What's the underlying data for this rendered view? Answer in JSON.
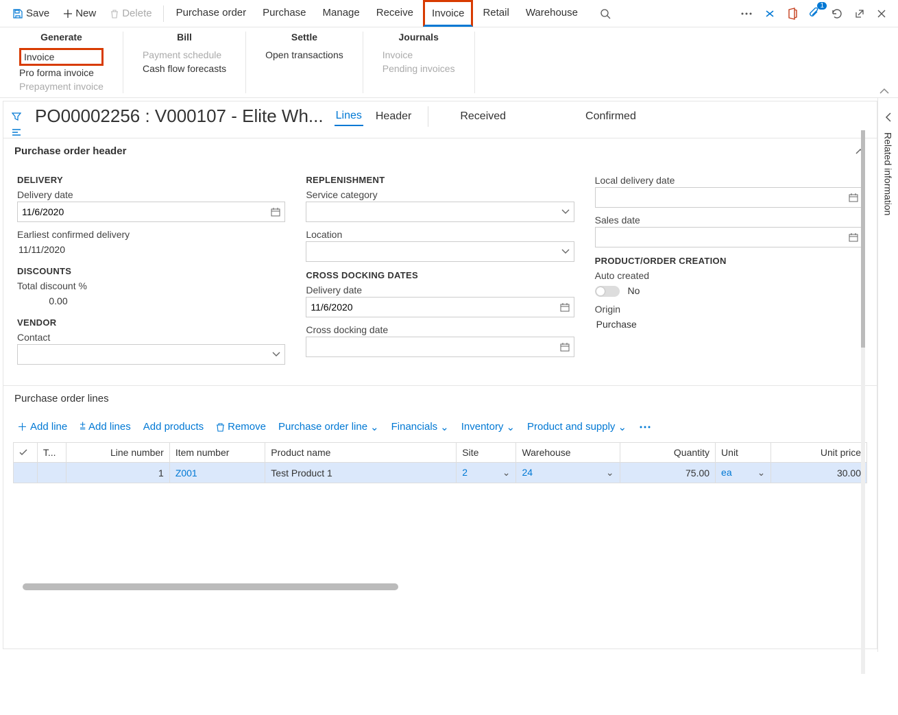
{
  "toolbar": {
    "save": "Save",
    "new": "New",
    "delete": "Delete",
    "tabs": [
      "Purchase order",
      "Purchase",
      "Manage",
      "Receive",
      "Invoice",
      "Retail",
      "Warehouse"
    ],
    "active_tab_index": 4,
    "badge_count": "1"
  },
  "ribbon": {
    "generate": {
      "title": "Generate",
      "items": [
        "Invoice",
        "Pro forma invoice",
        "Prepayment invoice"
      ],
      "disabled": [
        2
      ]
    },
    "bill": {
      "title": "Bill",
      "items": [
        "Payment schedule",
        "Cash flow forecasts"
      ],
      "disabled": [
        0
      ]
    },
    "settle": {
      "title": "Settle",
      "items": [
        "Open transactions"
      ]
    },
    "journals": {
      "title": "Journals",
      "items": [
        "Invoice",
        "Pending invoices"
      ],
      "disabled": [
        0,
        1
      ]
    }
  },
  "page": {
    "title": "PO00002256 : V000107 - Elite Wh...",
    "view_tabs": [
      "Lines",
      "Header"
    ],
    "active_view": 0,
    "status1": "Received",
    "status2": "Confirmed"
  },
  "header_section": {
    "title": "Purchase order header",
    "delivery": {
      "group": "DELIVERY",
      "delivery_date_label": "Delivery date",
      "delivery_date": "11/6/2020",
      "earliest_label": "Earliest confirmed delivery",
      "earliest": "11/11/2020"
    },
    "discounts": {
      "group": "DISCOUNTS",
      "total_pct_label": "Total discount %",
      "total_pct": "0.00"
    },
    "vendor": {
      "group": "VENDOR",
      "contact_label": "Contact",
      "contact": ""
    },
    "replenishment": {
      "group": "REPLENISHMENT",
      "service_cat_label": "Service category",
      "service_cat": "",
      "location_label": "Location",
      "location": ""
    },
    "cross_docking": {
      "group": "CROSS DOCKING DATES",
      "delivery_date_label": "Delivery date",
      "delivery_date": "11/6/2020",
      "cross_date_label": "Cross docking date",
      "cross_date": ""
    },
    "misc_dates": {
      "local_label": "Local delivery date",
      "local": "",
      "sales_label": "Sales date",
      "sales": ""
    },
    "product_order": {
      "group": "PRODUCT/ORDER CREATION",
      "auto_label": "Auto created",
      "auto_value": "No",
      "origin_label": "Origin",
      "origin_value": "Purchase"
    }
  },
  "lines_section": {
    "title": "Purchase order lines",
    "toolbar": {
      "add_line": "Add line",
      "add_lines": "Add lines",
      "add_products": "Add products",
      "remove": "Remove",
      "po_line": "Purchase order line",
      "financials": "Financials",
      "inventory": "Inventory",
      "product_supply": "Product and supply"
    },
    "columns": [
      "",
      "T...",
      "Line number",
      "Item number",
      "Product name",
      "Site",
      "Warehouse",
      "Quantity",
      "Unit",
      "Unit price"
    ],
    "rows": [
      {
        "t": "",
        "line_number": "1",
        "item_number": "Z001",
        "product_name": "Test Product 1",
        "site": "2",
        "warehouse": "24",
        "quantity": "75.00",
        "unit": "ea",
        "unit_price": "30.00"
      }
    ]
  },
  "related_info_label": "Related information"
}
